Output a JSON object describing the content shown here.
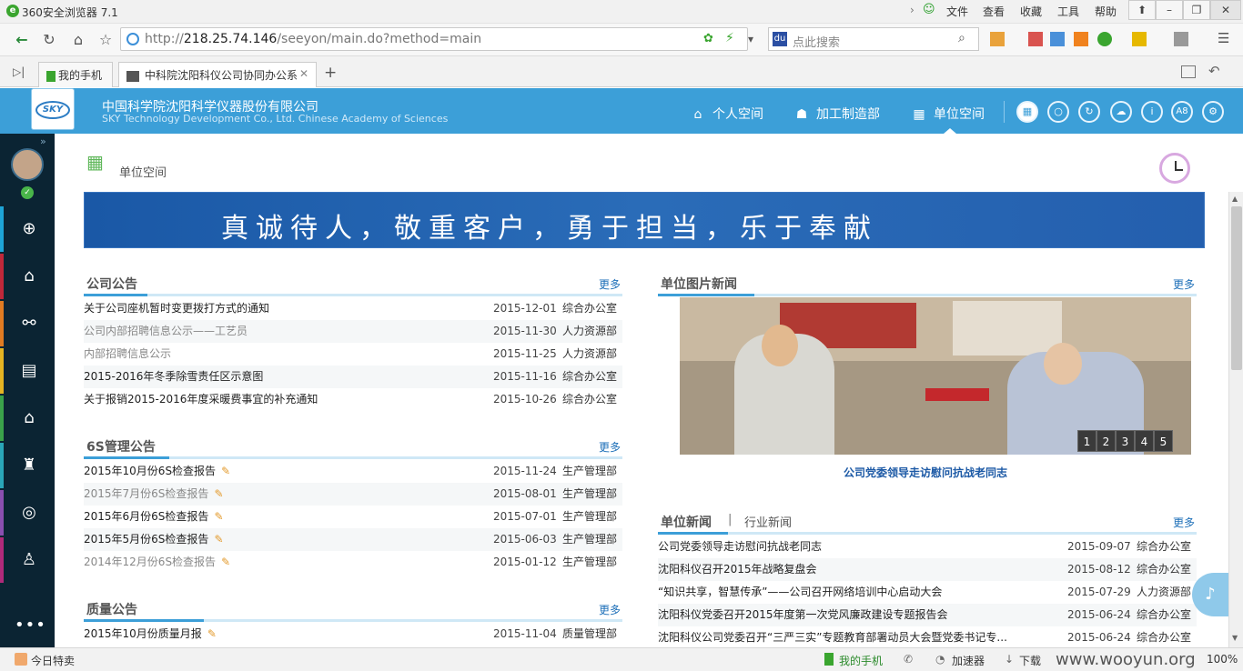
{
  "browser": {
    "title": "360安全浏览器 7.1",
    "menu": [
      "文件",
      "查看",
      "收藏",
      "工具",
      "帮助"
    ],
    "url_gray_prefix": "http://",
    "url_host": "218.25.74.146",
    "url_path": "/seeyon/main.do?method=main",
    "search_placeholder": "点此搜索",
    "tabs": [
      {
        "label": "我的手机"
      },
      {
        "label": "中科院沈阳科仪公司协同办公系"
      }
    ],
    "status_left": "今日特卖",
    "status_items": [
      "我的手机",
      "加速器",
      "下载"
    ],
    "zoom": "100%",
    "watermark": "www.wooyun.org"
  },
  "app": {
    "company_cn": "中国科学院沈阳科学仪器股份有限公司",
    "company_en": "SKY Technology Development Co., Ltd. Chinese Academy of Sciences",
    "logo_text": "SKY",
    "nav": [
      {
        "label": "个人空间",
        "icon": "home-icon"
      },
      {
        "label": "加工制造部",
        "icon": "group-icon"
      },
      {
        "label": "单位空间",
        "icon": "building-icon"
      }
    ],
    "tool_buttons": [
      "grid-icon",
      "search-icon",
      "refresh-icon",
      "cloud-icon",
      "info-icon",
      "A8",
      "gear-icon"
    ],
    "page_title": "单位空间",
    "slogan": "真诚待人，敬重客户，勇于担当，乐于奉献"
  },
  "sections": {
    "announcements": {
      "title": "公司公告",
      "more": "更多",
      "rows": [
        {
          "title": "关于公司座机暂时变更拨打方式的通知",
          "date": "2015-12-01",
          "dept": "综合办公室",
          "read": false
        },
        {
          "title": "公司内部招聘信息公示——工艺员",
          "date": "2015-11-30",
          "dept": "人力资源部",
          "read": true
        },
        {
          "title": "内部招聘信息公示",
          "date": "2015-11-25",
          "dept": "人力资源部",
          "read": true
        },
        {
          "title": "2015-2016年冬季除雪责任区示意图",
          "date": "2015-11-16",
          "dept": "综合办公室",
          "read": false
        },
        {
          "title": "关于报销2015-2016年度采暖费事宜的补充通知",
          "date": "2015-10-26",
          "dept": "综合办公室",
          "read": false
        }
      ]
    },
    "six_s": {
      "title": "6S管理公告",
      "more": "更多",
      "rows": [
        {
          "title": "2015年10月份6S检查报告",
          "date": "2015-11-24",
          "dept": "生产管理部",
          "read": false
        },
        {
          "title": "2015年7月份6S检查报告",
          "date": "2015-08-01",
          "dept": "生产管理部",
          "read": true
        },
        {
          "title": "2015年6月份6S检查报告",
          "date": "2015-07-01",
          "dept": "生产管理部",
          "read": false
        },
        {
          "title": "2015年5月份6S检查报告",
          "date": "2015-06-03",
          "dept": "生产管理部",
          "read": false
        },
        {
          "title": "2014年12月份6S检查报告",
          "date": "2015-01-12",
          "dept": "生产管理部",
          "read": true
        }
      ]
    },
    "quality": {
      "title": "质量公告",
      "more": "更多",
      "rows": [
        {
          "title": "2015年10月份质量月报",
          "date": "2015-11-04",
          "dept": "质量管理部",
          "read": false
        }
      ]
    },
    "photo_news": {
      "title": "单位图片新闻",
      "more": "更多",
      "caption": "公司党委领导走访慰问抗战老同志",
      "pages": [
        "1",
        "2",
        "3",
        "4",
        "5"
      ]
    },
    "unit_news": {
      "tab_active": "单位新闻",
      "tab_separator": "|",
      "tab_other": "行业新闻",
      "more": "更多",
      "rows": [
        {
          "title": "公司党委领导走访慰问抗战老同志",
          "date": "2015-09-07",
          "dept": "综合办公室"
        },
        {
          "title": "沈阳科仪召开2015年战略复盘会",
          "date": "2015-08-12",
          "dept": "综合办公室"
        },
        {
          "title": "“知识共享，智慧传承”——公司召开网络培训中心启动大会",
          "date": "2015-07-29",
          "dept": "人力资源部"
        },
        {
          "title": "沈阳科仪党委召开2015年度第一次党风廉政建设专题报告会",
          "date": "2015-06-24",
          "dept": "综合办公室"
        },
        {
          "title": "沈阳科仪公司党委召开“三严三实”专题教育部署动员大会暨党委书记专...",
          "date": "2015-06-24",
          "dept": "综合办公室"
        }
      ]
    }
  }
}
